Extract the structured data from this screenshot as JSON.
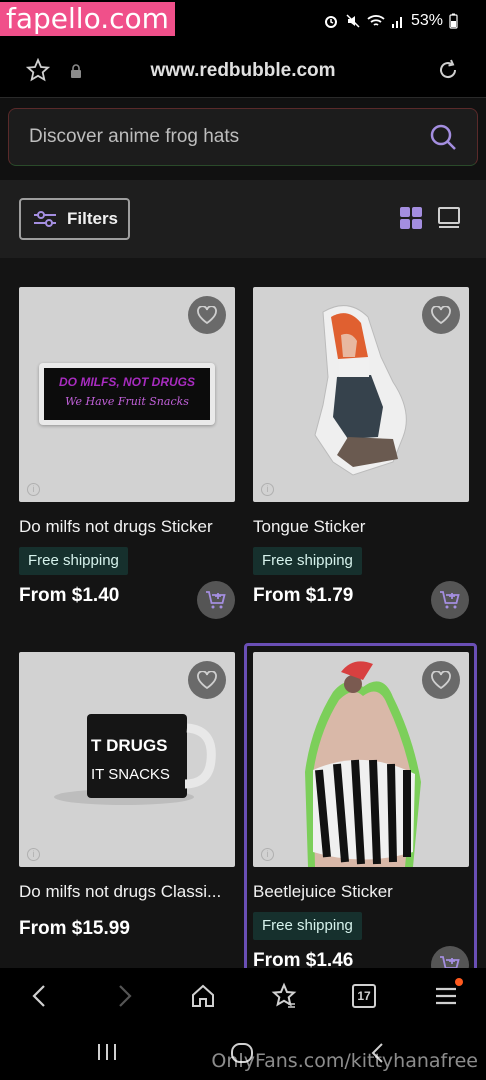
{
  "watermark": {
    "top": "fapello.com",
    "bottom": "OnlyFans.com/kittyhanafree"
  },
  "status": {
    "battery": "53%"
  },
  "browser": {
    "url": "www.redbubble.com"
  },
  "search": {
    "placeholder": "Discover anime frog hats"
  },
  "filters": {
    "label": "Filters"
  },
  "products": [
    {
      "title": "Do milfs not drugs Sticker",
      "shipping": "Free shipping",
      "price": "From $1.40",
      "art_line1": "DO MILFS, NOT DRUGS",
      "art_line2": "We Have Fruit Snacks"
    },
    {
      "title": "Tongue Sticker",
      "shipping": "Free shipping",
      "price": "From $1.79"
    },
    {
      "title": "Do milfs not drugs Classi...",
      "shipping": "",
      "price": "From $15.99",
      "art_line1": "T DRUGS",
      "art_line2": "IT SNACKS"
    },
    {
      "title": "Beetlejuice Sticker",
      "shipping": "Free shipping",
      "price": "From $1.46"
    }
  ],
  "colors": {
    "accent": "#6a4fb5",
    "shipping_bg": "#16302d",
    "watermark_pink": "#f0508a"
  },
  "nav": {
    "tabs_count": "17"
  }
}
